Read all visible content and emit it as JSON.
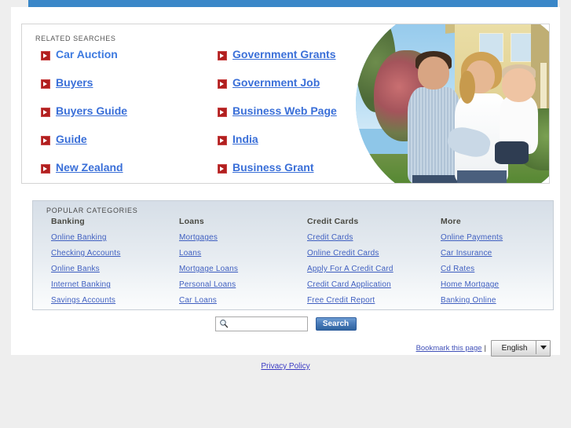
{
  "page": {
    "accent_blue": "#3a87c8",
    "link_blue": "#3a6fd8",
    "arrow_red": "#b11f1f"
  },
  "related_searches": {
    "title": "RELATED SEARCHES",
    "left_column": [
      {
        "label": "Car Auction",
        "icon": "arrow-right-icon",
        "underlined": false
      },
      {
        "label": "Buyers",
        "icon": "arrow-right-icon",
        "underlined": true
      },
      {
        "label": "Buyers Guide",
        "icon": "arrow-right-icon",
        "underlined": true
      },
      {
        "label": "Guide",
        "icon": "arrow-right-icon",
        "underlined": true
      },
      {
        "label": "New Zealand",
        "icon": "arrow-right-icon",
        "underlined": true
      }
    ],
    "right_column": [
      {
        "label": "Government Grants",
        "icon": "arrow-right-icon",
        "underlined": true
      },
      {
        "label": "Government Job",
        "icon": "arrow-right-icon",
        "underlined": true
      },
      {
        "label": "Business Web Page",
        "icon": "arrow-right-icon",
        "underlined": true
      },
      {
        "label": "India",
        "icon": "arrow-right-icon",
        "underlined": true
      },
      {
        "label": "Business Grant",
        "icon": "arrow-right-icon",
        "underlined": true
      }
    ],
    "photo_alt": "family-with-baby-in-front-of-house-photo"
  },
  "popular_categories": {
    "title": "POPULAR CATEGORIES",
    "columns": [
      {
        "heading": "Banking",
        "links": [
          "Online Banking",
          "Checking Accounts",
          "Online Banks",
          "Internet Banking",
          "Savings Accounts"
        ]
      },
      {
        "heading": "Loans",
        "links": [
          "Mortgages",
          "Loans",
          "Mortgage Loans",
          "Personal Loans",
          "Car Loans"
        ]
      },
      {
        "heading": "Credit Cards",
        "links": [
          "Credit Cards",
          "Online Credit Cards",
          "Apply For A Credit Card",
          "Credit Card Application",
          "Free Credit Report"
        ]
      },
      {
        "heading": "More",
        "links": [
          "Online Payments",
          "Car Insurance",
          "Cd Rates",
          "Home Mortgage",
          "Banking Online"
        ]
      }
    ]
  },
  "search": {
    "value": "",
    "placeholder": "",
    "button_label": "Search",
    "icon": "magnifier-icon"
  },
  "footer": {
    "bookmark_label": "Bookmark this page",
    "separator": "|",
    "language_selected": "English",
    "privacy_label": "Privacy Policy"
  }
}
